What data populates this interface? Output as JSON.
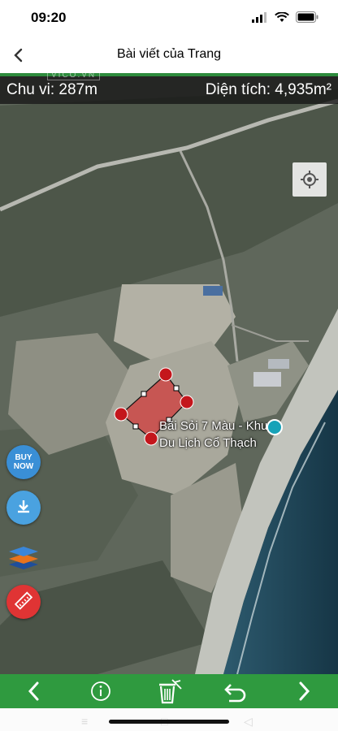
{
  "status_bar": {
    "time": "09:20"
  },
  "nav": {
    "title": "Bài viết của Trang"
  },
  "map": {
    "perimeter": "Chu vi: 287m",
    "area": "Diện tích: 4,935m²",
    "watermark": "VICO.VN",
    "poi_line1": "Bãi Sỏi 7 Màu - Khu",
    "poi_line2": "Du Lịch Cổ Thạch",
    "buy_now_label": "BUY NOW",
    "colors": {
      "polygon_fill": "#d23b3b",
      "vertex": "#c4161c",
      "toolbar": "#2f9a3f"
    }
  },
  "side_buttons": [
    {
      "name": "buy-now",
      "icon": "buy-now-badge"
    },
    {
      "name": "download",
      "icon": "download-icon"
    },
    {
      "name": "layers",
      "icon": "layers-icon"
    },
    {
      "name": "ruler",
      "icon": "ruler-icon"
    }
  ],
  "toolbar": [
    {
      "name": "prev",
      "icon": "chevron-left-icon"
    },
    {
      "name": "info",
      "icon": "info-icon"
    },
    {
      "name": "delete",
      "icon": "trash-icon"
    },
    {
      "name": "undo",
      "icon": "undo-icon"
    },
    {
      "name": "next",
      "icon": "chevron-right-icon"
    }
  ]
}
